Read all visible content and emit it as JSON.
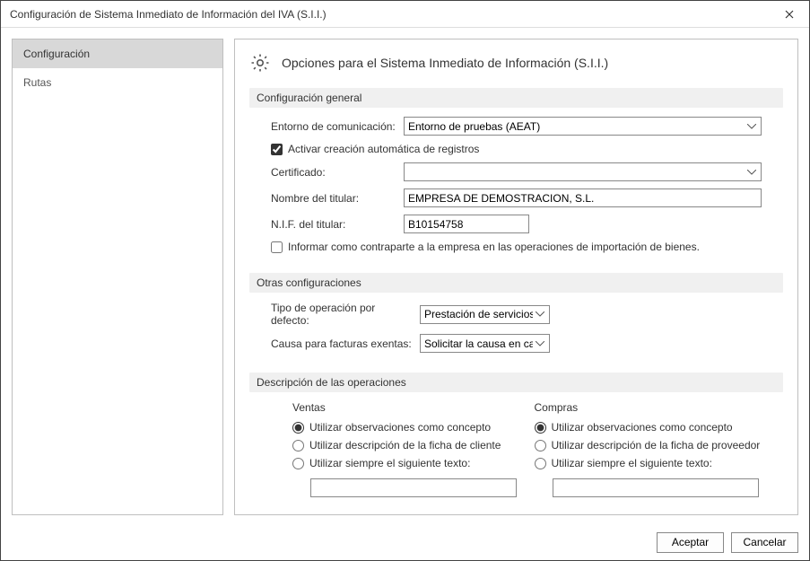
{
  "window": {
    "title": "Configuración de Sistema Inmediato de Información del IVA (S.I.I.)"
  },
  "sidebar": {
    "items": [
      {
        "label": "Configuración",
        "active": true
      },
      {
        "label": "Rutas",
        "active": false
      }
    ]
  },
  "header": {
    "title": "Opciones para el Sistema Inmediato de Información (S.I.I.)"
  },
  "sections": {
    "general": {
      "title": "Configuración general",
      "entorno_label": "Entorno de comunicación:",
      "entorno_value": "Entorno de pruebas (AEAT)",
      "auto_check_label": "Activar creación automática de registros",
      "auto_check": true,
      "certificado_label": "Certificado:",
      "certificado_value": "",
      "nombre_label": "Nombre del titular:",
      "nombre_value": "EMPRESA DE DEMOSTRACION, S.L.",
      "nif_label": "N.I.F. del titular:",
      "nif_value": "B10154758",
      "informar_label": "Informar como contraparte a la empresa en las operaciones de importación de bienes.",
      "informar_check": false
    },
    "otras": {
      "title": "Otras configuraciones",
      "tipo_label": "Tipo de operación por defecto:",
      "tipo_value": "Prestación de servicios",
      "causa_label": "Causa para facturas exentas:",
      "causa_value": "Solicitar la causa en cada"
    },
    "desc": {
      "title": "Descripción de las operaciones",
      "ventas": {
        "heading": "Ventas",
        "opt1": "Utilizar observaciones como concepto",
        "opt2": "Utilizar descripción de la ficha de cliente",
        "opt3": "Utilizar siempre el siguiente texto:",
        "selected": "opt1",
        "text_value": ""
      },
      "compras": {
        "heading": "Compras",
        "opt1": "Utilizar observaciones como concepto",
        "opt2": "Utilizar descripción de la ficha de proveedor",
        "opt3": "Utilizar siempre el siguiente texto:",
        "selected": "opt1",
        "text_value": ""
      }
    }
  },
  "buttons": {
    "accept": "Aceptar",
    "cancel": "Cancelar"
  }
}
